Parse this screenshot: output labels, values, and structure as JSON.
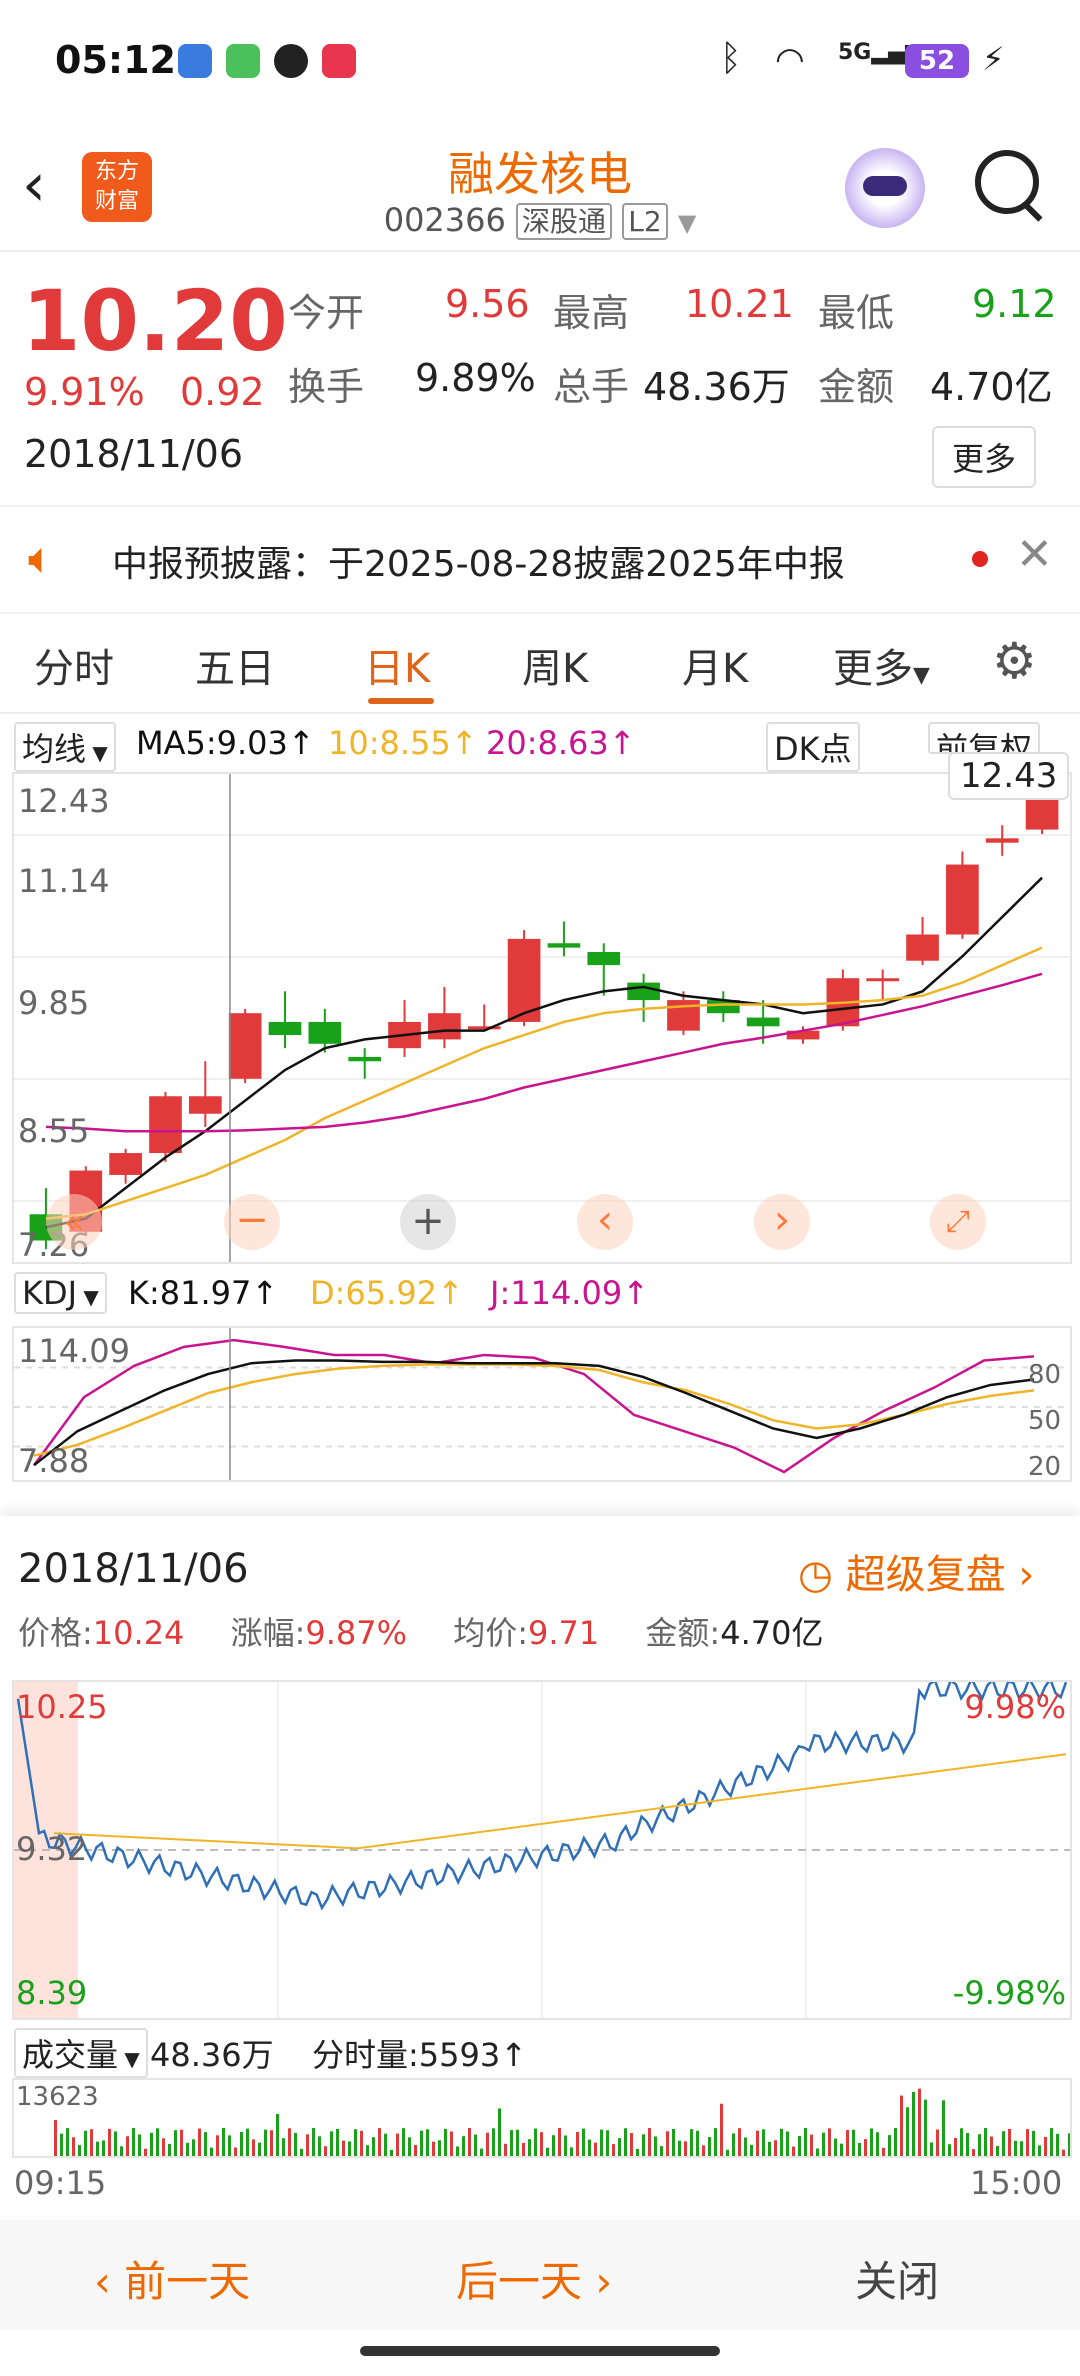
{
  "status_bar": {
    "time": "05:12",
    "battery": "52",
    "network": "5G"
  },
  "header": {
    "title": "融发核电",
    "code": "002366",
    "tag1": "深股通",
    "tag2": "L2",
    "logo_line1": "东方",
    "logo_line2": "财富"
  },
  "quote": {
    "price": "10.20",
    "change_pct": "9.91%",
    "change": "0.92",
    "date": "2018/11/06",
    "open_label": "今开",
    "open": "9.56",
    "high_label": "最高",
    "high": "10.21",
    "low_label": "最低",
    "low": "9.12",
    "turnover_label": "换手",
    "turnover": "9.89%",
    "volume_label": "总手",
    "volume": "48.36万",
    "amount_label": "金额",
    "amount": "4.70亿",
    "more": "更多"
  },
  "notice": {
    "text": "中报预披露：于2025-08-28披露2025年中报"
  },
  "tabs": [
    "分时",
    "五日",
    "日K",
    "周K",
    "月K",
    "更多"
  ],
  "active_tab": 2,
  "kline": {
    "ma_dropdown": "均线",
    "ma5": "MA5:9.03↑",
    "ma10": "10:8.55↑",
    "ma20": "20:8.63↑",
    "dk": "DK点",
    "fq": "前复权",
    "y_labels": [
      "12.43",
      "11.14",
      "9.85",
      "8.55",
      "7.26"
    ],
    "max_tag": "12.43"
  },
  "kdj": {
    "dropdown": "KDJ",
    "k": "K:81.97↑",
    "d": "D:65.92↑",
    "j": "J:114.09↑",
    "y_top": "114.09",
    "y_bottom": "7.88",
    "levels": [
      "80",
      "50",
      "20"
    ]
  },
  "chart_data": {
    "type": "candlestick",
    "y_range": [
      7.26,
      12.43
    ],
    "candles": [
      [
        7.6,
        7.3,
        7.9,
        7.2
      ],
      [
        7.4,
        8.1,
        8.15,
        7.35
      ],
      [
        8.05,
        8.3,
        8.35,
        7.95
      ],
      [
        8.3,
        8.95,
        9.0,
        8.2
      ],
      [
        8.75,
        8.95,
        9.35,
        8.6
      ],
      [
        9.15,
        9.9,
        9.95,
        9.1
      ],
      [
        9.8,
        9.65,
        10.15,
        9.5
      ],
      [
        9.8,
        9.55,
        9.95,
        9.45
      ],
      [
        9.4,
        9.35,
        9.5,
        9.15
      ],
      [
        9.5,
        9.8,
        10.05,
        9.4
      ],
      [
        9.6,
        9.9,
        10.2,
        9.5
      ],
      [
        9.75,
        9.75,
        10.0,
        9.7
      ],
      [
        9.8,
        10.75,
        10.85,
        9.75
      ],
      [
        10.7,
        10.65,
        10.95,
        10.55
      ],
      [
        10.6,
        10.45,
        10.7,
        10.1
      ],
      [
        10.25,
        10.05,
        10.35,
        9.8
      ],
      [
        9.7,
        10.05,
        10.15,
        9.65
      ],
      [
        10.05,
        9.9,
        10.15,
        9.8
      ],
      [
        9.85,
        9.75,
        10.05,
        9.55
      ],
      [
        9.6,
        9.7,
        9.75,
        9.55
      ],
      [
        9.75,
        10.3,
        10.4,
        9.7
      ],
      [
        10.3,
        10.3,
        10.4,
        10.05
      ],
      [
        10.5,
        10.8,
        11.0,
        10.45
      ],
      [
        10.8,
        11.6,
        11.75,
        10.75
      ],
      [
        11.85,
        11.9,
        12.05,
        11.7
      ],
      [
        12.0,
        12.35,
        12.43,
        11.95
      ]
    ],
    "ma5": [
      7.45,
      7.55,
      7.9,
      8.25,
      8.55,
      8.9,
      9.25,
      9.5,
      9.6,
      9.65,
      9.7,
      9.7,
      9.9,
      10.05,
      10.15,
      10.2,
      10.1,
      10.05,
      10.0,
      9.9,
      9.95,
      10.0,
      10.15,
      10.55,
      11.0,
      11.45
    ],
    "ma10": [
      7.55,
      7.6,
      7.75,
      7.9,
      8.05,
      8.25,
      8.45,
      8.7,
      8.9,
      9.1,
      9.3,
      9.5,
      9.65,
      9.8,
      9.9,
      9.95,
      9.98,
      10.0,
      10.0,
      10.0,
      10.02,
      10.05,
      10.1,
      10.25,
      10.45,
      10.65
    ],
    "ma20": [
      8.6,
      8.58,
      8.55,
      8.55,
      8.55,
      8.56,
      8.58,
      8.6,
      8.65,
      8.72,
      8.82,
      8.92,
      9.05,
      9.15,
      9.25,
      9.35,
      9.45,
      9.55,
      9.62,
      9.7,
      9.78,
      9.88,
      9.98,
      10.1,
      10.22,
      10.35
    ]
  },
  "kdj_data": {
    "k": [
      0.05,
      0.3,
      0.45,
      0.6,
      0.72,
      0.8,
      0.82,
      0.82,
      0.81,
      0.81,
      0.8,
      0.8,
      0.8,
      0.78,
      0.7,
      0.58,
      0.45,
      0.32,
      0.25,
      0.32,
      0.42,
      0.55,
      0.64,
      0.68
    ],
    "d": [
      0.12,
      0.2,
      0.32,
      0.45,
      0.58,
      0.66,
      0.72,
      0.76,
      0.78,
      0.79,
      0.79,
      0.79,
      0.78,
      0.75,
      0.66,
      0.6,
      0.5,
      0.38,
      0.32,
      0.35,
      0.42,
      0.5,
      0.56,
      0.6
    ],
    "j": [
      0.05,
      0.55,
      0.78,
      0.92,
      0.97,
      0.92,
      0.86,
      0.86,
      0.8,
      0.86,
      0.84,
      0.72,
      0.42,
      0.3,
      0.18,
      0.0,
      0.25,
      0.45,
      0.62,
      0.82,
      0.85
    ]
  },
  "intraday": {
    "date": "2018/11/06",
    "replay": "超级复盘",
    "price_label": "价格:",
    "price": "10.24",
    "chg_label": "涨幅:",
    "chg": "9.87%",
    "avg_label": "均价:",
    "avg": "9.71",
    "amt_label": "金额:",
    "amt": "4.70亿",
    "y_top": "10.25",
    "y_mid": "9.32",
    "y_bottom": "8.39",
    "pct_top": "9.98%",
    "pct_bottom": "-9.98%"
  },
  "volume": {
    "dropdown": "成交量",
    "total": "48.36万",
    "tick": "分时量:5593↑",
    "y_top": "13623",
    "t_start": "09:15",
    "t_end": "15:00"
  },
  "bottom_nav": {
    "prev": "前一天",
    "next": "后一天",
    "close": "关闭"
  },
  "colors": {
    "up": "#e03a3a",
    "down": "#1aa11a",
    "accent": "#ee6a00",
    "ma5": "#111111",
    "ma10": "#f0b429",
    "ma20": "#c8158f"
  }
}
